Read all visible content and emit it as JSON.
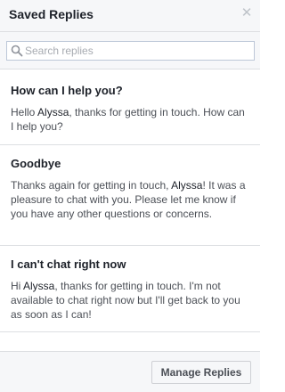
{
  "header": {
    "title": "Saved Replies",
    "close_icon": "close-icon"
  },
  "search": {
    "placeholder": "Search replies",
    "value": ""
  },
  "replies": [
    {
      "title": "How can I help you?",
      "text_before": "Hello ",
      "name": "Alyssa",
      "text_after": ", thanks for getting in touch. How can I help you?"
    },
    {
      "title": "Goodbye",
      "text_before": "Thanks again for getting in touch, ",
      "name": "Alyssa",
      "text_after": "! It was a pleasure to chat with you. Please let me know if you have any other questions or concerns."
    },
    {
      "title": "I can't chat right now",
      "text_before": "Hi ",
      "name": "Alyssa",
      "text_after": ", thanks for getting in touch. I'm not available to chat right now but I'll get back to you as soon as I can!"
    }
  ],
  "footer": {
    "manage_label": "Manage Replies"
  },
  "colors": {
    "header_bg": "#f6f7f9",
    "border": "#dddfe2",
    "text": "#1d2129",
    "muted": "#4b4f56"
  }
}
